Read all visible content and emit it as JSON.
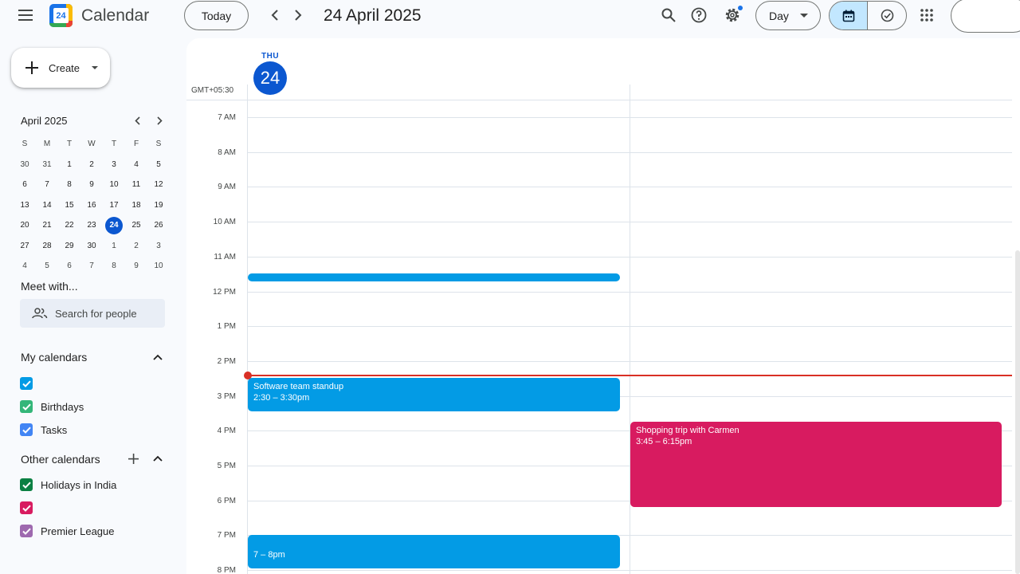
{
  "header": {
    "app_name": "Calendar",
    "logo_day": "24",
    "today_label": "Today",
    "date_title": "24 April 2025",
    "view_label": "Day"
  },
  "sidebar": {
    "create_label": "Create",
    "mini_calendar": {
      "month_label": "April 2025",
      "weekdays": [
        "S",
        "M",
        "T",
        "W",
        "T",
        "F",
        "S"
      ],
      "weeks": [
        [
          "30",
          "31",
          "1",
          "2",
          "3",
          "4",
          "5"
        ],
        [
          "6",
          "7",
          "8",
          "9",
          "10",
          "11",
          "12"
        ],
        [
          "13",
          "14",
          "15",
          "16",
          "17",
          "18",
          "19"
        ],
        [
          "20",
          "21",
          "22",
          "23",
          "24",
          "25",
          "26"
        ],
        [
          "27",
          "28",
          "29",
          "30",
          "1",
          "2",
          "3"
        ],
        [
          "4",
          "5",
          "6",
          "7",
          "8",
          "9",
          "10"
        ]
      ]
    },
    "meet_with": {
      "title": "Meet with...",
      "search_placeholder": "Search for people"
    },
    "my_calendars": {
      "title": "My calendars",
      "items": [
        {
          "label": "",
          "color": "#039be5"
        },
        {
          "label": "Birthdays",
          "color": "#33b679"
        },
        {
          "label": "Tasks",
          "color": "#4285f4"
        }
      ]
    },
    "other_calendars": {
      "title": "Other calendars",
      "items": [
        {
          "label": "Holidays in India",
          "color": "#0b8043"
        },
        {
          "label": "",
          "color": "#d81b60"
        },
        {
          "label": "Premier League",
          "color": "#9e69af"
        }
      ]
    }
  },
  "day_view": {
    "weekday": "THU",
    "day_number": "24",
    "timezone": "GMT+05:30",
    "hours": [
      "7 AM",
      "8 AM",
      "9 AM",
      "10 AM",
      "11 AM",
      "12 PM",
      "1 PM",
      "2 PM",
      "3 PM",
      "4 PM",
      "5 PM",
      "6 PM",
      "7 PM",
      "8 PM"
    ],
    "events": {
      "standup": {
        "title": "Software team standup",
        "time": "2:30 – 3:30pm",
        "color": "#039be5"
      },
      "shopping": {
        "title": "Shopping trip with Carmen",
        "time": "3:45 – 6:15pm",
        "color": "#d81b60"
      },
      "evening": {
        "title": "",
        "time": "7 – 8pm",
        "color": "#039be5"
      },
      "noon": {
        "title": "",
        "color": "#039be5"
      }
    },
    "now_color": "#d93025"
  },
  "icons": {
    "menu": "menu-icon",
    "search": "search-icon",
    "help": "help-icon",
    "settings": "gear-icon",
    "apps": "apps-grid-icon"
  }
}
